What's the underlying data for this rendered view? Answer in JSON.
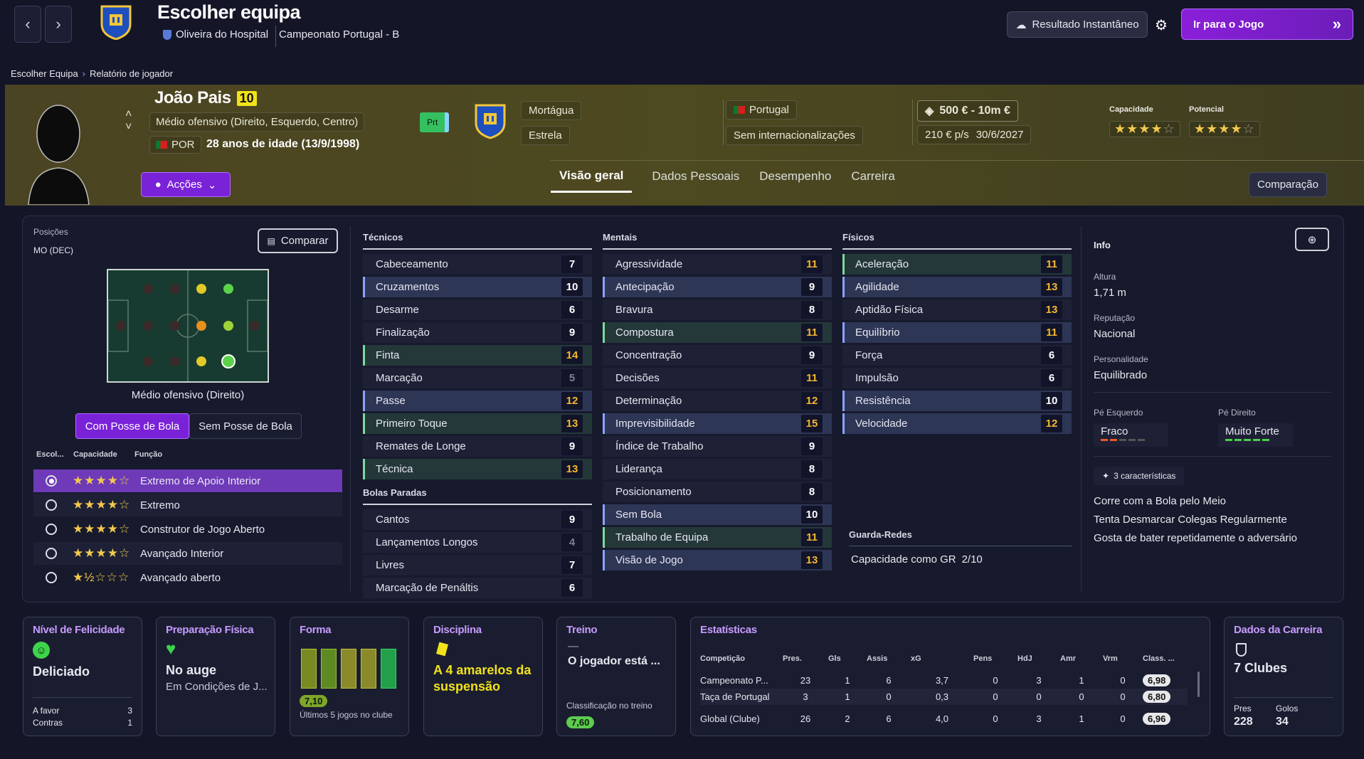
{
  "topbar": {
    "title": "Escolher equipa",
    "club": "Oliveira do Hospital",
    "competition": "Campeonato Portugal - B",
    "instant_result": "Resultado Instantâneo",
    "go_to_game": "Ir para o Jogo"
  },
  "breadcrumb": {
    "root": "Escolher Equipa",
    "current": "Relatório de jogador"
  },
  "player": {
    "name": "João Pais",
    "number": "10",
    "position": "Médio ofensivo (Direito, Esquerdo, Centro)",
    "nationality_code": "POR",
    "age": "28 anos de idade (13/9/1998)",
    "status_badge": "Prt",
    "actions_label": "Acções",
    "club_name": "Mortágua",
    "club_status": "Estrela",
    "country": "Portugal",
    "caps": "Sem internacionalizações",
    "value": "500 € - 10m €",
    "wage": "210 € p/s",
    "contract": "30/6/2027",
    "capacity_label": "Capacidade",
    "potential_label": "Potencial",
    "capacity_stars": 4,
    "potential_stars": 4
  },
  "tabs": [
    "Visão geral",
    "Dados Pessoais",
    "Desempenho",
    "Carreira"
  ],
  "compare_btn": "Comparação",
  "positions": {
    "label": "Posições",
    "value": "MO (DEC)",
    "compare": "Comparar",
    "caption": "Médio ofensivo (Direito)",
    "with_ball": "Com Posse de Bola",
    "without_ball": "Sem Posse de Bola",
    "headers": [
      "Escol...",
      "Capacidade",
      "Função"
    ],
    "roles": [
      {
        "name": "Extremo de Apoio Interior",
        "stars": "★★★★☆",
        "selected": true
      },
      {
        "name": "Extremo",
        "stars": "★★★★☆",
        "selected": false
      },
      {
        "name": "Construtor de Jogo Aberto",
        "stars": "★★★★☆",
        "selected": false
      },
      {
        "name": "Avançado Interior",
        "stars": "★★★★☆",
        "selected": false
      },
      {
        "name": "Avançado aberto",
        "stars": "★½☆☆☆",
        "selected": false
      }
    ]
  },
  "attributes": {
    "technical_title": "Técnicos",
    "technical": [
      {
        "n": "Cabeceamento",
        "v": "7"
      },
      {
        "n": "Cruzamentos",
        "v": "10"
      },
      {
        "n": "Desarme",
        "v": "6"
      },
      {
        "n": "Finalização",
        "v": "9"
      },
      {
        "n": "Finta",
        "v": "14"
      },
      {
        "n": "Marcação",
        "v": "5"
      },
      {
        "n": "Passe",
        "v": "12"
      },
      {
        "n": "Primeiro Toque",
        "v": "13"
      },
      {
        "n": "Remates de Longe",
        "v": "9"
      },
      {
        "n": "Técnica",
        "v": "13"
      }
    ],
    "setpieces_title": "Bolas Paradas",
    "setpieces": [
      {
        "n": "Cantos",
        "v": "9"
      },
      {
        "n": "Lançamentos Longos",
        "v": "4"
      },
      {
        "n": "Livres",
        "v": "7"
      },
      {
        "n": "Marcação de Penáltis",
        "v": "6"
      }
    ],
    "mental_title": "Mentais",
    "mental": [
      {
        "n": "Agressividade",
        "v": "11"
      },
      {
        "n": "Antecipação",
        "v": "9"
      },
      {
        "n": "Bravura",
        "v": "8"
      },
      {
        "n": "Compostura",
        "v": "11"
      },
      {
        "n": "Concentração",
        "v": "9"
      },
      {
        "n": "Decisões",
        "v": "11"
      },
      {
        "n": "Determinação",
        "v": "12"
      },
      {
        "n": "Imprevisibilidade",
        "v": "15"
      },
      {
        "n": "Índice de Trabalho",
        "v": "9"
      },
      {
        "n": "Liderança",
        "v": "8"
      },
      {
        "n": "Posicionamento",
        "v": "8"
      },
      {
        "n": "Sem Bola",
        "v": "10"
      },
      {
        "n": "Trabalho de Equipa",
        "v": "11"
      },
      {
        "n": "Visão de Jogo",
        "v": "13"
      }
    ],
    "physical_title": "Físicos",
    "physical": [
      {
        "n": "Aceleração",
        "v": "11"
      },
      {
        "n": "Agilidade",
        "v": "13"
      },
      {
        "n": "Aptidão Física",
        "v": "13"
      },
      {
        "n": "Equilíbrio",
        "v": "11"
      },
      {
        "n": "Força",
        "v": "6"
      },
      {
        "n": "Impulsão",
        "v": "6"
      },
      {
        "n": "Resistência",
        "v": "10"
      },
      {
        "n": "Velocidade",
        "v": "12"
      }
    ],
    "gk_title": "Guarda-Redes",
    "gk_value": "Capacidade como GR",
    "gk_score": "2/10"
  },
  "info": {
    "title": "Info",
    "height_label": "Altura",
    "height": "1,71 m",
    "reputation_label": "Reputação",
    "reputation": "Nacional",
    "personality_label": "Personalidade",
    "personality": "Equilibrado",
    "left_foot_label": "Pé Esquerdo",
    "left_foot": "Fraco",
    "right_foot_label": "Pé Direito",
    "right_foot": "Muito Forte",
    "traits_badge": "3 características",
    "traits": [
      "Corre com a Bola pelo Meio",
      "Tenta Desmarcar Colegas Regularmente",
      "Gosta de bater repetidamente o adversário"
    ]
  },
  "cards": {
    "happiness": {
      "title": "Nível de Felicidade",
      "value": "Deliciado",
      "for_label": "A favor",
      "for": "3",
      "against_label": "Contras",
      "against": "1"
    },
    "fitness": {
      "title": "Preparação Física",
      "value": "No auge",
      "sub": "Em Condições de J..."
    },
    "form": {
      "title": "Forma",
      "rating": "7,10",
      "sub": "Últimos 5 jogos no clube"
    },
    "discipline": {
      "title": "Disciplina",
      "value": "A 4 amarelos da suspensão"
    },
    "training": {
      "title": "Treino",
      "dash": "—",
      "value": "O jogador está ...",
      "sub": "Classificação no treino",
      "rating": "7,60"
    },
    "stats": {
      "title": "Estatísticas",
      "headers": [
        "Competição",
        "Pres.",
        "Gls",
        "Assis",
        "xG",
        "Pens",
        "HdJ",
        "Amr",
        "Vrm",
        "Class. ..."
      ],
      "rows": [
        [
          "Campeonato P...",
          "23",
          "1",
          "6",
          "3,7",
          "0",
          "3",
          "1",
          "0",
          "6,98"
        ],
        [
          "Taça de Portugal",
          "3",
          "1",
          "0",
          "0,3",
          "0",
          "0",
          "0",
          "0",
          "6,80"
        ],
        [
          "Global (Clube)",
          "26",
          "2",
          "6",
          "4,0",
          "0",
          "3",
          "1",
          "0",
          "6,96"
        ]
      ]
    },
    "career": {
      "title": "Dados da Carreira",
      "value": "7 Clubes",
      "apps_label": "Pres",
      "apps": "228",
      "goals_label": "Golos",
      "goals": "34"
    }
  },
  "colors": {
    "accent": "#8a2be2",
    "highlight_yellow": "#f5b82e",
    "header_band": "#4a4620"
  }
}
